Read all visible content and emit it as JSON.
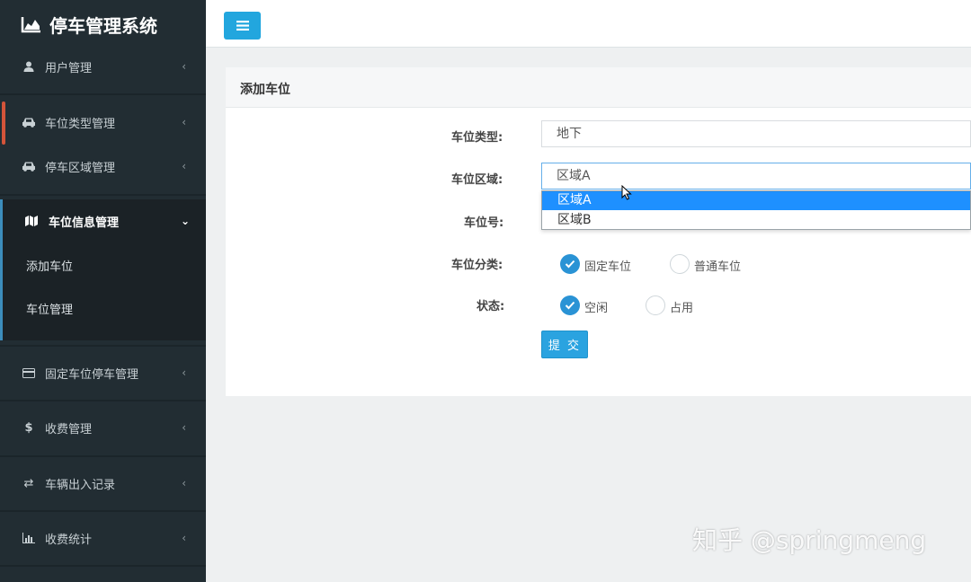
{
  "app": {
    "title": "停车管理系统"
  },
  "sidebar": {
    "items": [
      {
        "label": "用户管理",
        "icon": "user-icon"
      },
      {
        "label": "车位类型管理",
        "icon": "car-icon"
      },
      {
        "label": "停车区域管理",
        "icon": "car-icon"
      },
      {
        "label": "车位信息管理",
        "icon": "map-icon",
        "expanded": true,
        "children": [
          {
            "label": "添加车位"
          },
          {
            "label": "车位管理"
          }
        ]
      },
      {
        "label": "固定车位停车管理",
        "icon": "credit-card-icon"
      },
      {
        "label": "收费管理",
        "icon": "dollar-icon"
      },
      {
        "label": "车辆出入记录",
        "icon": "exchange-icon"
      },
      {
        "label": "收费统计",
        "icon": "bar-chart-icon"
      }
    ]
  },
  "card": {
    "title": "添加车位"
  },
  "form": {
    "type_label": "车位类型:",
    "type_value": "地下",
    "area_label": "车位区域:",
    "area_value": "区域A",
    "area_options": [
      "区域A",
      "区域B"
    ],
    "number_label": "车位号:",
    "category_label": "车位分类:",
    "category_options": [
      {
        "label": "固定车位",
        "checked": true
      },
      {
        "label": "普通车位",
        "checked": false
      }
    ],
    "status_label": "状态:",
    "status_options": [
      {
        "label": "空闲",
        "checked": true
      },
      {
        "label": "占用",
        "checked": false
      }
    ],
    "submit_label": "提 交"
  },
  "watermark": "知乎 @springmeng",
  "colors": {
    "sidebar_bg": "#222d33",
    "accent": "#22a6de",
    "active_border": "#3c8dbc",
    "selected_option": "#1e90ff",
    "radio_on": "#2a93d5"
  }
}
